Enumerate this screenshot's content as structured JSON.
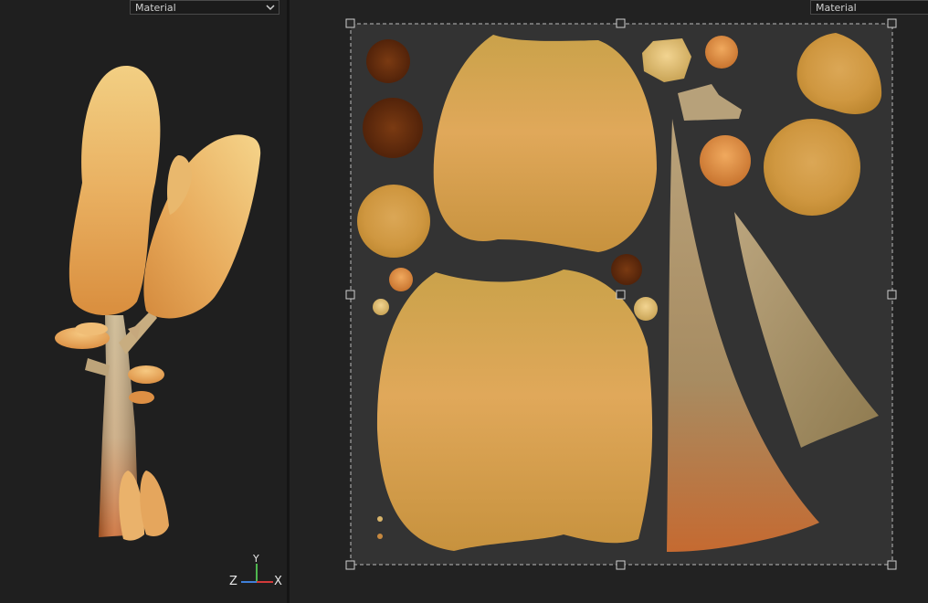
{
  "viewport_3d": {
    "material_dropdown": {
      "value": "Material"
    },
    "axis_gizmo": {
      "x_label": "X",
      "y_label": "Y",
      "z_label": "Z"
    }
  },
  "uv_editor": {
    "material_dropdown": {
      "value": "Material"
    }
  },
  "colors": {
    "panel_bg": "#1f1f1f",
    "uv_area_bg": "#333333",
    "selection_border": "#bbbbbb",
    "axis_x": "#d23a3a",
    "axis_y": "#4fb64f",
    "axis_z": "#3f7fd8"
  },
  "icons": {
    "dropdown_arrow": "chevron-down-icon"
  }
}
